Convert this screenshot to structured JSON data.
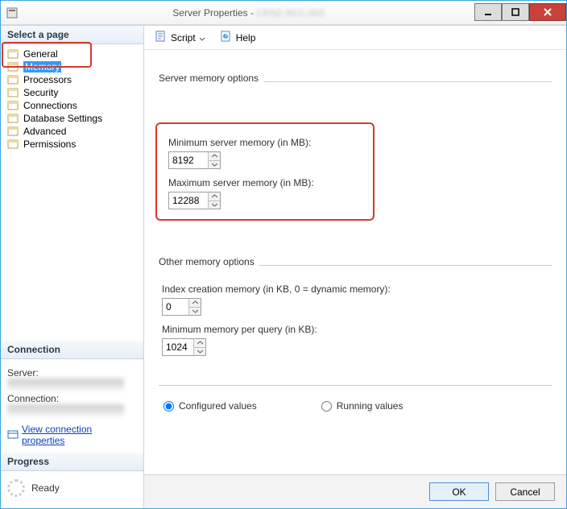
{
  "titlebar": {
    "title": "Server Properties -",
    "server_blur": "CEN2-SCC-001"
  },
  "winbtns": {
    "min": "minimize",
    "max": "maximize",
    "close": "close"
  },
  "left": {
    "select_page": "Select a page",
    "pages": {
      "general": "General",
      "memory": "Memory",
      "processors": "Processors",
      "security": "Security",
      "connections": "Connections",
      "database_settings": "Database Settings",
      "advanced": "Advanced",
      "permissions": "Permissions"
    },
    "connection_hdr": "Connection",
    "server_label": "Server:",
    "connection_label": "Connection:",
    "view_conn_props": "View connection properties",
    "progress_hdr": "Progress",
    "progress_status": "Ready"
  },
  "toolbar": {
    "script": "Script",
    "help": "Help"
  },
  "form": {
    "server_memory_options": "Server memory options",
    "min_mem_label": "Minimum server memory (in MB):",
    "min_mem_value": "8192",
    "max_mem_label": "Maximum server memory (in MB):",
    "max_mem_value": "12288",
    "other_memory_options": "Other memory options",
    "index_mem_label": "Index creation memory (in KB, 0 = dynamic memory):",
    "index_mem_value": "0",
    "min_query_label": "Minimum memory per query (in KB):",
    "min_query_value": "1024",
    "configured": "Configured values",
    "running": "Running values"
  },
  "footer": {
    "ok": "OK",
    "cancel": "Cancel"
  }
}
